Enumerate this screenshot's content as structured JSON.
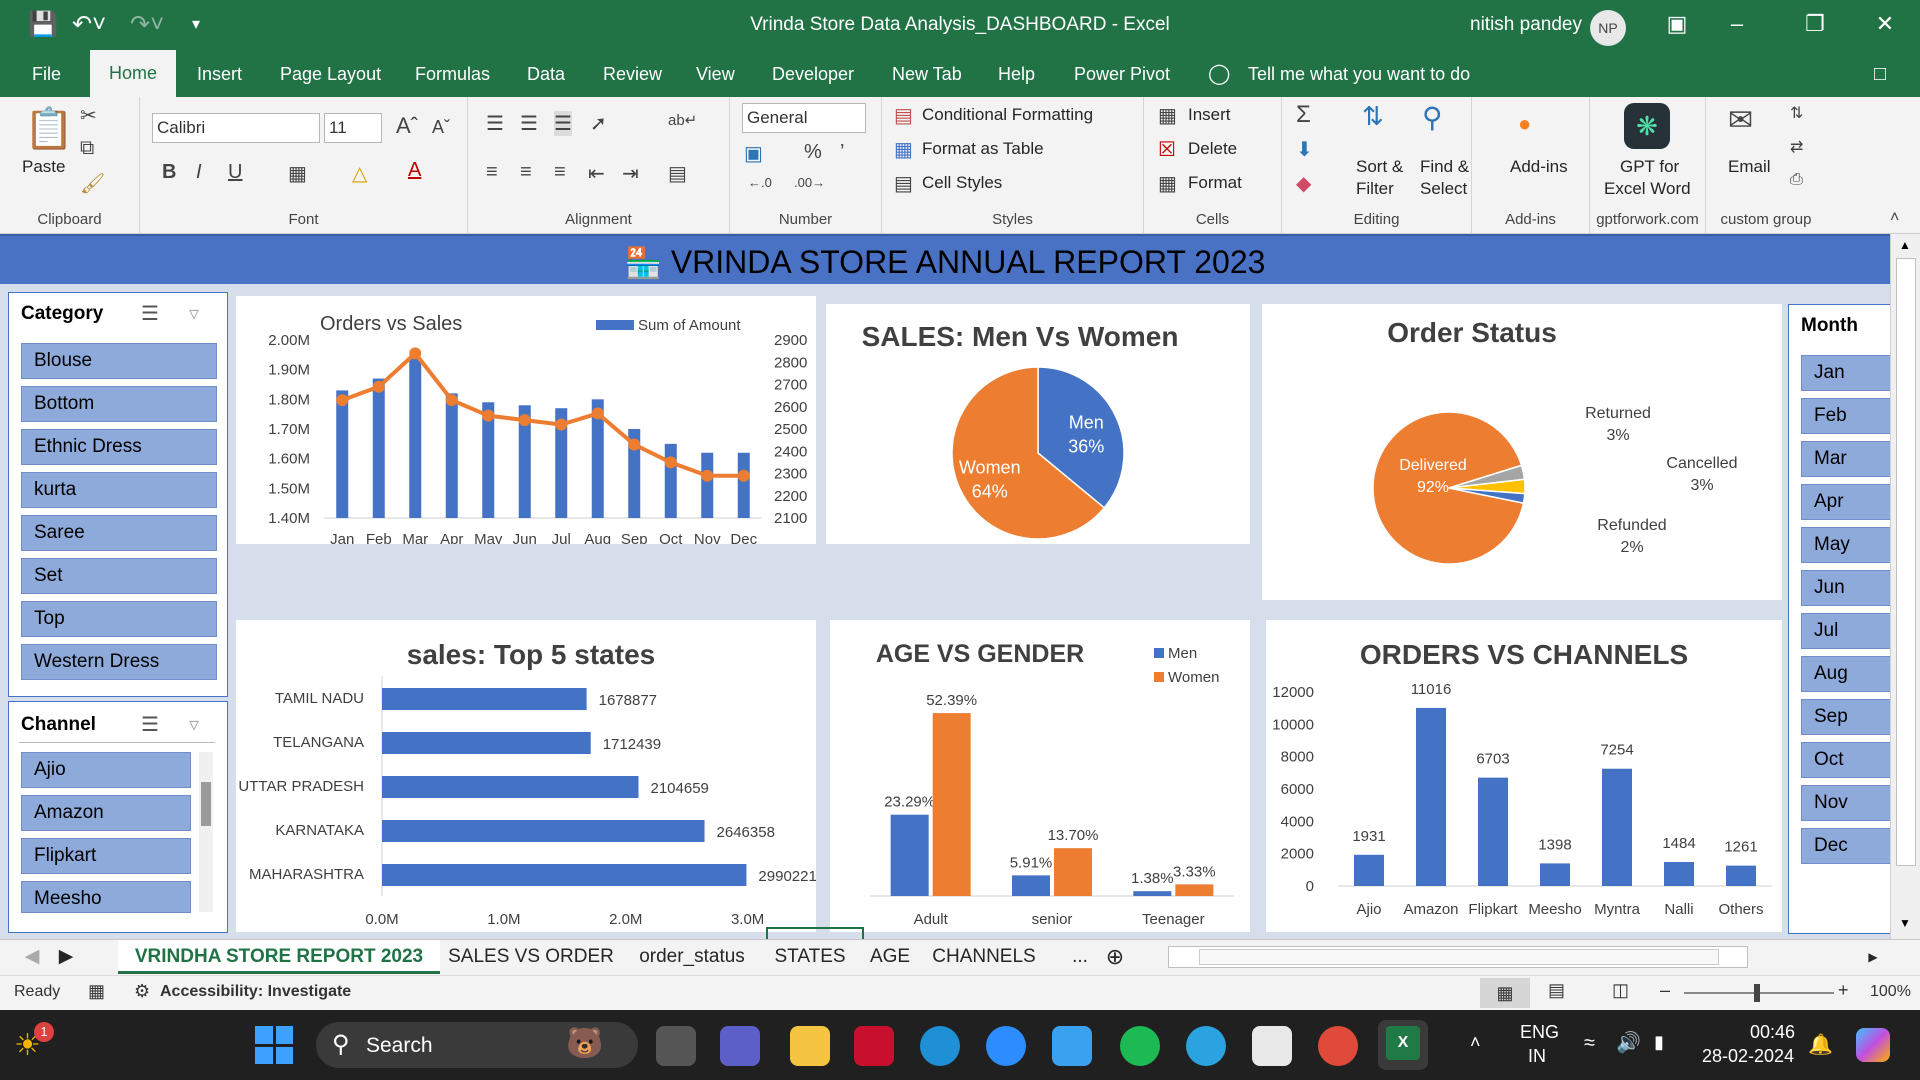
{
  "titlebar": {
    "doc_title": "Vrinda Store Data Analysis_DASHBOARD  -  Excel",
    "user": "nitish pandey",
    "avatar": "NP"
  },
  "ribbon_tabs": [
    "File",
    "Home",
    "Insert",
    "Page Layout",
    "Formulas",
    "Data",
    "Review",
    "View",
    "Developer",
    "New Tab",
    "Help",
    "Power Pivot"
  ],
  "tell_me": "Tell me what you want to do",
  "ribbon": {
    "clipboard": {
      "paste": "Paste",
      "label": "Clipboard"
    },
    "font": {
      "name": "Calibri",
      "size": "11",
      "label": "Font"
    },
    "alignment": {
      "label": "Alignment"
    },
    "number": {
      "format": "General",
      "label": "Number"
    },
    "styles": {
      "cond": "Conditional Formatting",
      "table": "Format as Table",
      "cell": "Cell Styles",
      "label": "Styles"
    },
    "cells": {
      "insert": "Insert",
      "delete": "Delete",
      "format": "Format",
      "label": "Cells"
    },
    "editing": {
      "sort": "Sort &",
      "sort2": "Filter",
      "find": "Find &",
      "find2": "Select",
      "label": "Editing"
    },
    "addins": {
      "btn": "Add-ins",
      "label": "Add-ins"
    },
    "gpt": {
      "btn1": "GPT for",
      "btn2": "Excel Word",
      "label": "gptforwork.com"
    },
    "custom": {
      "btn": "Email",
      "label": "custom group"
    }
  },
  "dashboard_title": "VRINDA STORE ANNUAL REPORT 2023",
  "category_slicer": {
    "title": "Category",
    "items": [
      "Blouse",
      "Bottom",
      "Ethnic Dress",
      "kurta",
      "Saree",
      "Set",
      "Top",
      "Western Dress"
    ]
  },
  "channel_slicer": {
    "title": "Channel",
    "items": [
      "Ajio",
      "Amazon",
      "Flipkart",
      "Meesho"
    ]
  },
  "month_slicer": {
    "title": "Month",
    "items": [
      "Jan",
      "Feb",
      "Mar",
      "Apr",
      "May",
      "Jun",
      "Jul",
      "Aug",
      "Sep",
      "Oct",
      "Nov",
      "Dec"
    ]
  },
  "chart_data": [
    {
      "type": "bar",
      "title": "Orders vs Sales",
      "legend": "Sum of Amount",
      "categories": [
        "Jan",
        "Feb",
        "Mar",
        "Apr",
        "May",
        "Jun",
        "Jul",
        "Aug",
        "Sep",
        "Oct",
        "Nov",
        "Dec"
      ],
      "series": [
        {
          "name": "Sum of Amount",
          "values": [
            1.83,
            1.87,
            1.94,
            1.82,
            1.79,
            1.78,
            1.77,
            1.8,
            1.7,
            1.65,
            1.62,
            1.62
          ]
        }
      ],
      "line_values": [
        2630,
        2690,
        2840,
        2630,
        2560,
        2540,
        2520,
        2570,
        2430,
        2350,
        2290,
        2290
      ],
      "y_left_ticks": [
        "2.00M",
        "1.90M",
        "1.80M",
        "1.70M",
        "1.60M",
        "1.50M",
        "1.40M"
      ],
      "y_right_ticks": [
        "2900",
        "2800",
        "2700",
        "2600",
        "2500",
        "2400",
        "2300",
        "2200",
        "2100"
      ],
      "ylim": [
        1.4,
        2.0
      ],
      "y2lim": [
        2100,
        2900
      ]
    },
    {
      "type": "pie",
      "title": "SALES: Men Vs Women",
      "labels": [
        "Men",
        "Women"
      ],
      "values": [
        36,
        64
      ],
      "value_labels": [
        "36%",
        "64%"
      ]
    },
    {
      "type": "pie",
      "title": "Order Status",
      "labels": [
        "Delivered",
        "Returned",
        "Cancelled",
        "Refunded"
      ],
      "values": [
        92,
        3,
        3,
        2
      ],
      "value_labels": [
        "92%",
        "3%",
        "3%",
        "2%"
      ]
    },
    {
      "type": "bar",
      "title": "sales: Top 5 states",
      "categories": [
        "TAMIL NADU",
        "TELANGANA",
        "UTTAR PRADESH",
        "KARNATAKA",
        "MAHARASHTRA"
      ],
      "values": [
        1678877,
        1712439,
        2104659,
        2646358,
        2990221
      ],
      "x_ticks": [
        "0.0M",
        "1.0M",
        "2.0M",
        "3.0M"
      ],
      "xlim": [
        0,
        3200000
      ]
    },
    {
      "type": "bar",
      "title": "AGE VS GENDER",
      "categories": [
        "Adult",
        "senior",
        "Teenager"
      ],
      "series": [
        {
          "name": "Men",
          "values": [
            23.29,
            5.91,
            1.38
          ],
          "labels": [
            "23.29%",
            "5.91%",
            "1.38%"
          ]
        },
        {
          "name": "Women",
          "values": [
            52.39,
            13.7,
            3.33
          ],
          "labels": [
            "52.39%",
            "13.70%",
            "3.33%"
          ]
        }
      ]
    },
    {
      "type": "bar",
      "title": "ORDERS VS CHANNELS",
      "categories": [
        "Ajio",
        "Amazon",
        "Flipkart",
        "Meesho",
        "Myntra",
        "Nalli",
        "Others"
      ],
      "values": [
        1931,
        11016,
        6703,
        1398,
        7254,
        1484,
        1261
      ],
      "y_ticks": [
        "12000",
        "10000",
        "8000",
        "6000",
        "4000",
        "2000",
        "0"
      ],
      "ylim": [
        0,
        12000
      ]
    }
  ],
  "sheet_tabs": [
    "VRINDHA STORE REPORT 2023",
    "SALES VS ORDER",
    "order_status",
    "STATES",
    "AGE",
    "CHANNELS"
  ],
  "sheet_more": "...",
  "status": {
    "ready": "Ready",
    "accessibility": "Accessibility: Investigate",
    "zoom": "100%"
  },
  "taskbar": {
    "search": "Search",
    "lang1": "ENG",
    "lang2": "IN",
    "time": "00:46",
    "date": "28-02-2024",
    "badge": "1"
  },
  "colors": {
    "excel_green": "#217346",
    "blue": "#4472c4",
    "orange": "#ed7d31",
    "banner": "#4a72c4",
    "slicer_item": "#8eaadb"
  }
}
